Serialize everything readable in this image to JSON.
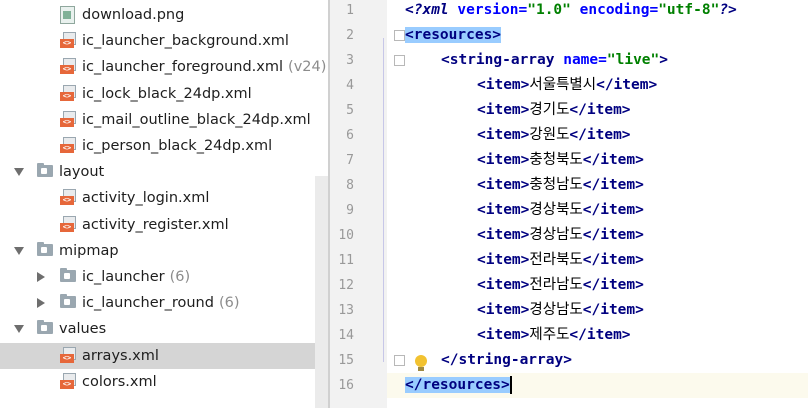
{
  "tree": {
    "rows": [
      {
        "label": "download.png",
        "suffix": "",
        "icon": "png-file-icon"
      },
      {
        "label": "ic_launcher_background.xml",
        "suffix": "",
        "icon": "xml-file-icon"
      },
      {
        "label": "ic_launcher_foreground.xml",
        "suffix": "(v24)",
        "icon": "xml-file-icon"
      },
      {
        "label": "ic_lock_black_24dp.xml",
        "suffix": "",
        "icon": "xml-file-icon"
      },
      {
        "label": "ic_mail_outline_black_24dp.xml",
        "suffix": "",
        "icon": "xml-file-icon"
      },
      {
        "label": "ic_person_black_24dp.xml",
        "suffix": "",
        "icon": "xml-file-icon"
      },
      {
        "label": "layout",
        "suffix": "",
        "icon": "folder-icon",
        "expanded": true
      },
      {
        "label": "activity_login.xml",
        "suffix": "",
        "icon": "xml-file-icon"
      },
      {
        "label": "activity_register.xml",
        "suffix": "",
        "icon": "xml-file-icon"
      },
      {
        "label": "mipmap",
        "suffix": "",
        "icon": "folder-icon",
        "expanded": true
      },
      {
        "label": "ic_launcher",
        "suffix": "(6)",
        "icon": "folder-icon",
        "expanded": false
      },
      {
        "label": "ic_launcher_round",
        "suffix": "(6)",
        "icon": "folder-icon",
        "expanded": false
      },
      {
        "label": "values",
        "suffix": "",
        "icon": "folder-icon",
        "expanded": true
      },
      {
        "label": "arrays.xml",
        "suffix": "",
        "icon": "xml-file-icon",
        "selected": true
      },
      {
        "label": "colors.xml",
        "suffix": "",
        "icon": "xml-file-icon"
      }
    ]
  },
  "editor": {
    "line_numbers": [
      "1",
      "2",
      "3",
      "4",
      "5",
      "6",
      "7",
      "8",
      "9",
      "10",
      "11",
      "12",
      "13",
      "14",
      "15",
      "16"
    ],
    "xml_decl": {
      "open": "<?xml ",
      "attr1": "version=",
      "val1": "\"1.0\"",
      "attr2": "encoding=",
      "val2": "\"utf-8\"",
      "close": "?>"
    },
    "resources_open": "<resources>",
    "string_array_open": {
      "tag": "<string-array ",
      "attr": "name=",
      "val": "\"live\"",
      "close": ">"
    },
    "item_open": "<item>",
    "item_close": "</item>",
    "items": [
      "서울특별시",
      "경기도",
      "강원도",
      "충청북도",
      "충청남도",
      "경상북도",
      "경상남도",
      "전라북도",
      "전라남도",
      "경상남도",
      "제주도"
    ],
    "string_array_close": "</string-array>",
    "resources_close": "</resources>"
  }
}
